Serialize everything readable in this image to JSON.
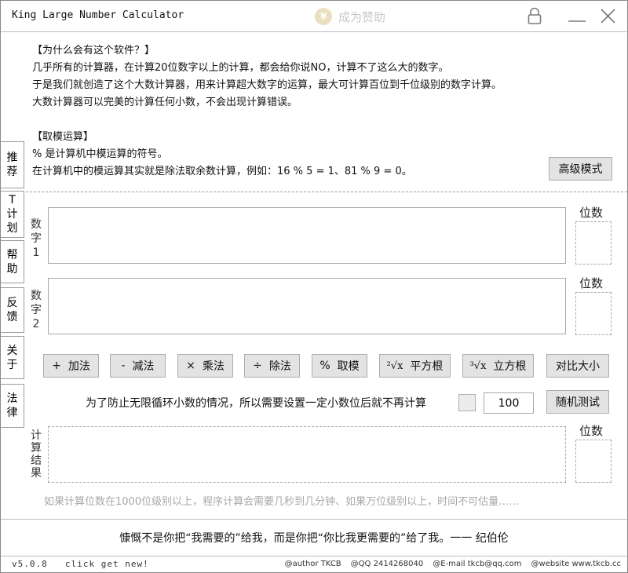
{
  "window": {
    "title": "King Large Number Calculator",
    "sponsor_label": "成为赞助",
    "sponsor_coin": "¥"
  },
  "intro": {
    "why_heading": "【为什么会有这个软件？】",
    "why_lines": [
      "几乎所有的计算器，在计算20位数字以上的计算，都会给你说NO，计算不了这么大的数字。",
      "于是我们就创造了这个大数计算器，用来计算超大数字的运算，最大可计算百位到千位级别的数字计算。",
      "大数计算器可以完美的计算任何小数，不会出现计算错误。"
    ],
    "mod_heading": "【取模运算】",
    "mod_lines": [
      "% 是计算机中模运算的符号。",
      "在计算机中的模运算其实就是除法取余数计算，例如：16 % 5 = 1、81 % 9 = 0。"
    ],
    "advanced_button": "高级模式"
  },
  "sidebar": {
    "tabs": [
      "推荐",
      "T计划",
      "帮助",
      "反馈",
      "关于",
      "法律"
    ]
  },
  "inputs": {
    "number1_label": "数字1",
    "number2_label": "数字2",
    "digits_label": "位数",
    "number1_value": "",
    "number2_value": ""
  },
  "operations": {
    "add": {
      "symbol": "+",
      "label": "加法"
    },
    "subtract": {
      "symbol": "-",
      "label": "减法"
    },
    "multiply": {
      "symbol": "×",
      "label": "乘法"
    },
    "divide": {
      "symbol": "÷",
      "label": "除法"
    },
    "modulo": {
      "symbol": "%",
      "label": "取模"
    },
    "sqrt": {
      "symbol": "²√x",
      "label": "平方根"
    },
    "cbrt": {
      "symbol": "³√x",
      "label": "立方根"
    },
    "compare": {
      "label": "对比大小"
    }
  },
  "precision": {
    "text": "为了防止无限循环小数的情况，所以需要设置一定小数位后就不再计算",
    "checked": false,
    "value": "100",
    "random_button": "随机测试"
  },
  "result": {
    "label": "计算结果",
    "digits_label": "位数",
    "warning": "如果计算位数在1000位级别以上，程序计算会需要几秒到几分钟、如果万位级别以上，时间不可估量……"
  },
  "quote": "慷慨不是你把“我需要的”给我，而是你把“你比我更需要的”给了我。一一 纪伯伦",
  "footer": {
    "version": "v5.0.8",
    "click_new": "click get new!",
    "author": "@author TKCB",
    "qq": "@QQ 2414268040",
    "email": "@E-mail tkcb@qq.com",
    "website": "@website www.tkcb.cc"
  },
  "colors": {
    "border": "#adadad",
    "button_bg": "#e3e3e3",
    "warning_text": "#a8a8a8",
    "sponsor_text": "#c8c8c8"
  }
}
